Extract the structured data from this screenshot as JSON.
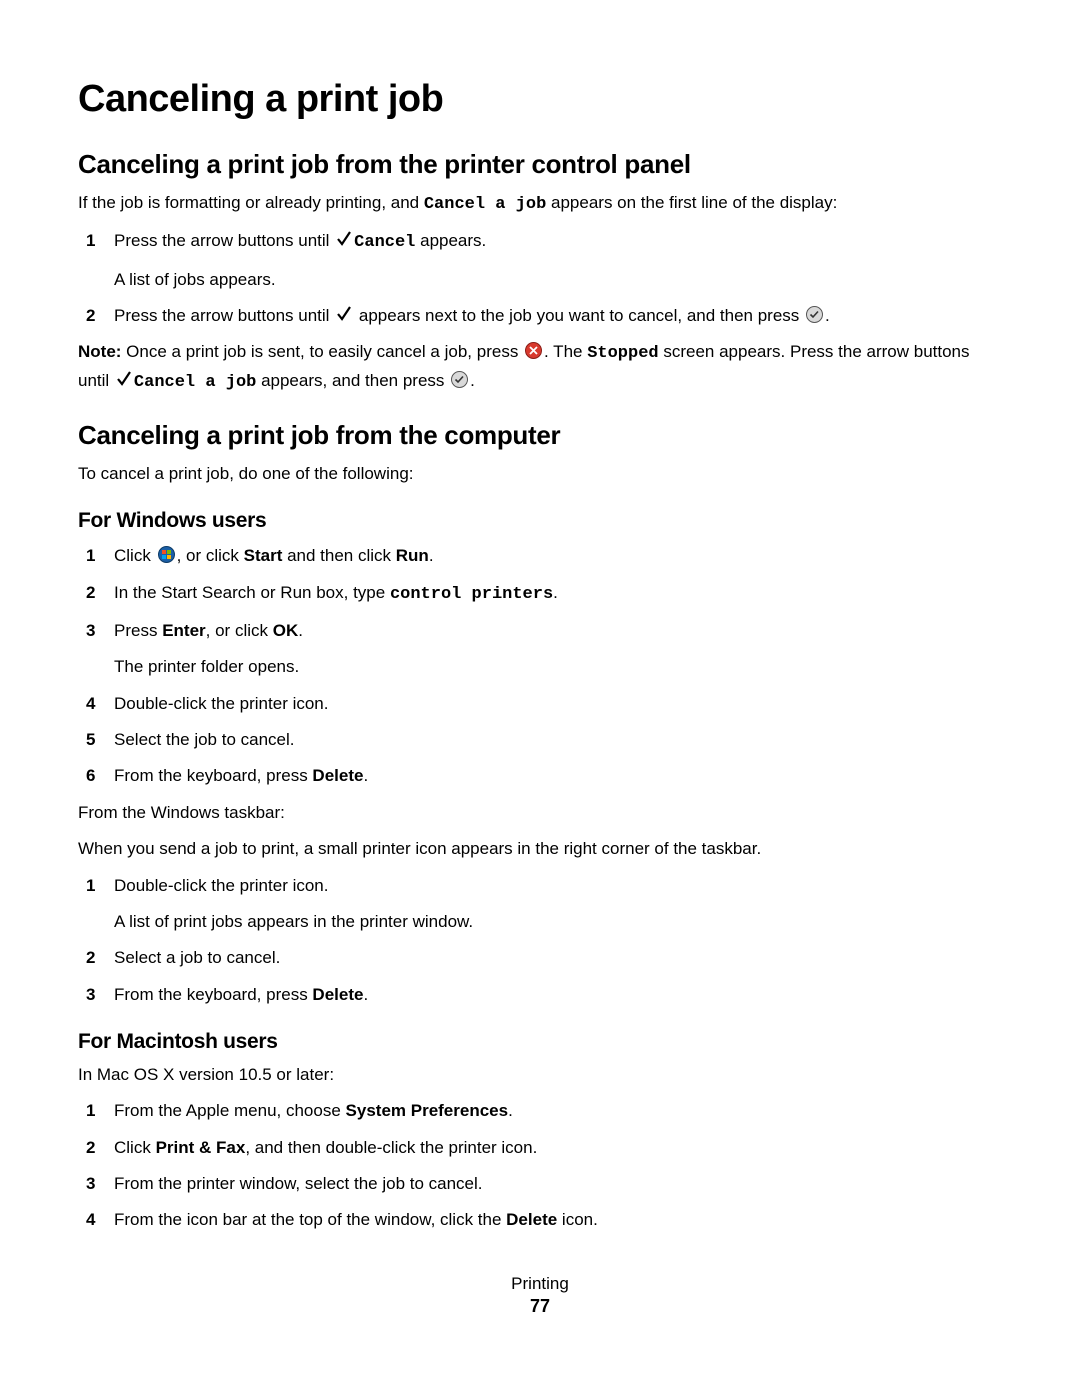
{
  "title": "Canceling a print job",
  "section1": {
    "heading": "Canceling a print job from the printer control panel",
    "intro_part1": "If the job is formatting or already printing, and ",
    "intro_mono": "Cancel a job",
    "intro_part2": " appears on the first line of the display:",
    "step1_a": "Press the arrow buttons until ",
    "step1_mono": "Cancel",
    "step1_b": " appears.",
    "step1_sub": "A list of jobs appears.",
    "step2_a": "Press the arrow buttons until ",
    "step2_b": " appears next to the job you want to cancel, and then press ",
    "step2_c": ".",
    "note_lead": "Note: ",
    "note_a": "Once a print job is sent, to easily cancel a job, press ",
    "note_b": ". The ",
    "note_mono": "Stopped",
    "note_c": " screen appears. Press the arrow buttons until ",
    "note_mono2": "Cancel a job",
    "note_d": " appears, and then press ",
    "note_e": "."
  },
  "section2": {
    "heading": "Canceling a print job from the computer",
    "intro": "To cancel a print job, do one of the following:",
    "windows": {
      "heading": "For Windows users",
      "s1_a": "Click ",
      "s1_b": ", or click ",
      "s1_bold1": "Start",
      "s1_c": " and then click ",
      "s1_bold2": "Run",
      "s1_d": ".",
      "s2_a": "In the Start Search or Run box, type ",
      "s2_mono": "control printers",
      "s2_b": ".",
      "s3_a": "Press ",
      "s3_bold1": "Enter",
      "s3_b": ", or click ",
      "s3_bold2": "OK",
      "s3_c": ".",
      "s3_sub": "The printer folder opens.",
      "s4": "Double-click the printer icon.",
      "s5": "Select the job to cancel.",
      "s6_a": "From the keyboard, press ",
      "s6_bold": "Delete",
      "s6_b": ".",
      "taskbar_intro": "From the Windows taskbar:",
      "taskbar_desc": "When you send a job to print, a small printer icon appears in the right corner of the taskbar.",
      "t1": "Double-click the printer icon.",
      "t1_sub": "A list of print jobs appears in the printer window.",
      "t2": "Select a job to cancel.",
      "t3_a": "From the keyboard, press ",
      "t3_bold": "Delete",
      "t3_b": "."
    },
    "mac": {
      "heading": "For Macintosh users",
      "intro": "In Mac OS X version 10.5 or later:",
      "m1_a": "From the Apple menu, choose ",
      "m1_bold": "System Preferences",
      "m1_b": ".",
      "m2_a": "Click ",
      "m2_bold": "Print & Fax",
      "m2_b": ", and then double-click the printer icon.",
      "m3": "From the printer window, select the job to cancel.",
      "m4_a": "From the icon bar at the top of the window, click the ",
      "m4_bold": "Delete",
      "m4_b": " icon."
    }
  },
  "footer": {
    "chapter": "Printing",
    "page": "77"
  }
}
